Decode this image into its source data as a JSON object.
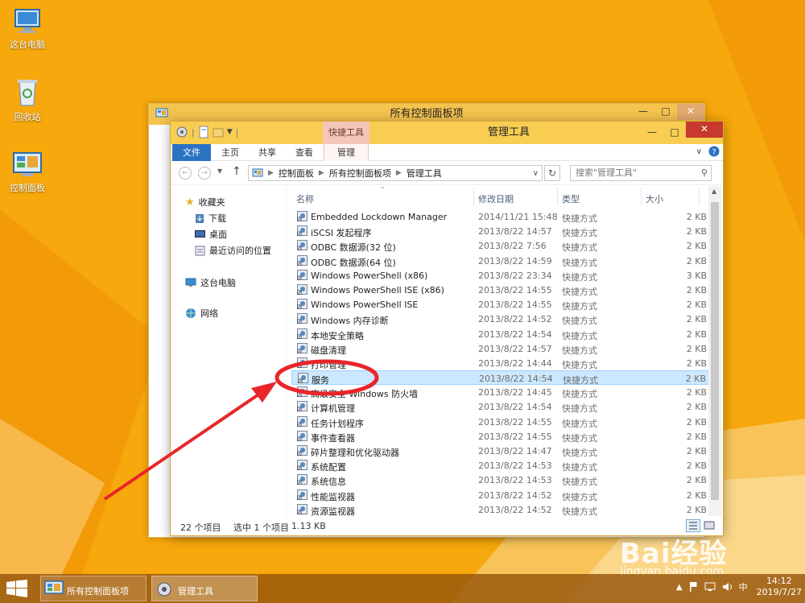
{
  "desktop": {
    "icons": [
      {
        "label": "这台电脑"
      },
      {
        "label": "回收站"
      },
      {
        "label": "控制面板"
      }
    ]
  },
  "back_window": {
    "title": "所有控制面板项"
  },
  "window": {
    "title": "管理工具",
    "contextual_tab_group": "快捷工具",
    "ribbon_tabs": [
      "文件",
      "主页",
      "共享",
      "查看",
      "管理"
    ],
    "address": {
      "breadcrumb": [
        "控制面板",
        "所有控制面板项",
        "管理工具"
      ]
    },
    "search_placeholder": "搜索\"管理工具\"",
    "nav_pane": {
      "favorites": "收藏夹",
      "favorites_items": [
        "下载",
        "桌面",
        "最近访问的位置"
      ],
      "this_pc": "这台电脑",
      "network": "网络"
    },
    "columns": {
      "name": "名称",
      "date": "修改日期",
      "type": "类型",
      "size": "大小"
    },
    "files": [
      {
        "name": "Embedded Lockdown Manager",
        "date": "2014/11/21 15:48",
        "type": "快捷方式",
        "size": "2 KB"
      },
      {
        "name": "iSCSI 发起程序",
        "date": "2013/8/22 14:57",
        "type": "快捷方式",
        "size": "2 KB"
      },
      {
        "name": "ODBC 数据源(32 位)",
        "date": "2013/8/22 7:56",
        "type": "快捷方式",
        "size": "2 KB"
      },
      {
        "name": "ODBC 数据源(64 位)",
        "date": "2013/8/22 14:59",
        "type": "快捷方式",
        "size": "2 KB"
      },
      {
        "name": "Windows PowerShell (x86)",
        "date": "2013/8/22 23:34",
        "type": "快捷方式",
        "size": "3 KB"
      },
      {
        "name": "Windows PowerShell ISE (x86)",
        "date": "2013/8/22 14:55",
        "type": "快捷方式",
        "size": "2 KB"
      },
      {
        "name": "Windows PowerShell ISE",
        "date": "2013/8/22 14:55",
        "type": "快捷方式",
        "size": "2 KB"
      },
      {
        "name": "Windows 内存诊断",
        "date": "2013/8/22 14:52",
        "type": "快捷方式",
        "size": "2 KB"
      },
      {
        "name": "本地安全策略",
        "date": "2013/8/22 14:54",
        "type": "快捷方式",
        "size": "2 KB"
      },
      {
        "name": "磁盘清理",
        "date": "2013/8/22 14:57",
        "type": "快捷方式",
        "size": "2 KB"
      },
      {
        "name": "打印管理",
        "date": "2013/8/22 14:44",
        "type": "快捷方式",
        "size": "2 KB"
      },
      {
        "name": "服务",
        "date": "2013/8/22 14:54",
        "type": "快捷方式",
        "size": "2 KB",
        "selected": true
      },
      {
        "name": "高级安全 Windows 防火墙",
        "date": "2013/8/22 14:45",
        "type": "快捷方式",
        "size": "2 KB"
      },
      {
        "name": "计算机管理",
        "date": "2013/8/22 14:54",
        "type": "快捷方式",
        "size": "2 KB"
      },
      {
        "name": "任务计划程序",
        "date": "2013/8/22 14:55",
        "type": "快捷方式",
        "size": "2 KB"
      },
      {
        "name": "事件查看器",
        "date": "2013/8/22 14:55",
        "type": "快捷方式",
        "size": "2 KB"
      },
      {
        "name": "碎片整理和优化驱动器",
        "date": "2013/8/22 14:47",
        "type": "快捷方式",
        "size": "2 KB"
      },
      {
        "name": "系统配置",
        "date": "2013/8/22 14:53",
        "type": "快捷方式",
        "size": "2 KB"
      },
      {
        "name": "系统信息",
        "date": "2013/8/22 14:53",
        "type": "快捷方式",
        "size": "2 KB"
      },
      {
        "name": "性能监视器",
        "date": "2013/8/22 14:52",
        "type": "快捷方式",
        "size": "2 KB"
      },
      {
        "name": "资源监视器",
        "date": "2013/8/22 14:52",
        "type": "快捷方式",
        "size": "2 KB"
      }
    ],
    "status": {
      "count": "22 个项目",
      "selection": "选中 1 个项目",
      "size": "1.13 KB"
    }
  },
  "taskbar": {
    "tasks": [
      {
        "label": "所有控制面板项"
      },
      {
        "label": "管理工具"
      }
    ],
    "ime": "中",
    "time": "14:12",
    "date": "2019/7/27"
  },
  "watermark": {
    "logo": "Bai经验",
    "url": "jingyan.baidu.com"
  },
  "colors": {
    "desktop": "#f6a80c",
    "title_bar": "#f8cd52",
    "accent": "#2a73c3",
    "selection": "#cce8ff",
    "annotation": "#e8262a"
  }
}
